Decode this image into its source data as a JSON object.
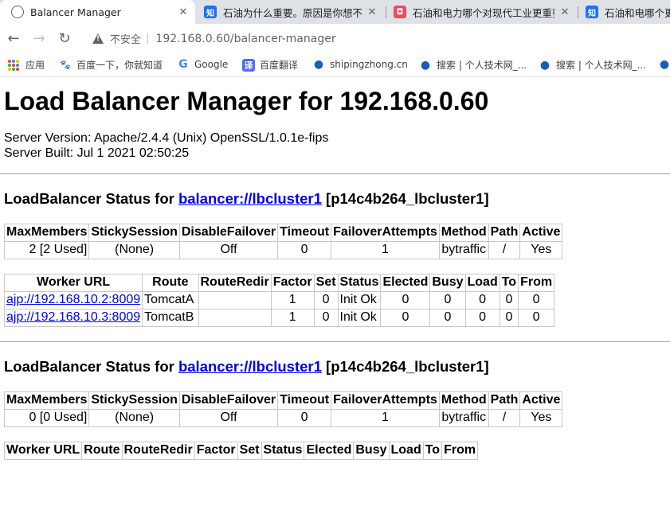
{
  "browser": {
    "tabs": [
      {
        "title": "Balancer Manager",
        "close": "✕",
        "icon": "globe-icon"
      },
      {
        "title": "石油为什么重要。原因是你想不到",
        "close": "✕",
        "icon": "zhihu-icon"
      },
      {
        "title": "石油和电力哪个对现代工业更重要",
        "close": "✕",
        "icon": "bilibili-icon"
      },
      {
        "title": "石油和电哪个更重",
        "close": "",
        "icon": "zhihu-icon"
      }
    ],
    "security_label": "不安全",
    "url": "192.168.0.60/balancer-manager",
    "bookmarks": [
      {
        "label": "应用",
        "icon": "apps-grid-icon"
      },
      {
        "label": "百度一下，你就知道",
        "icon": "baidu-paw-icon"
      },
      {
        "label": "Google",
        "icon": "google-g-icon"
      },
      {
        "label": "百度翻译",
        "icon": "baidu-translate-icon"
      },
      {
        "label": "shipingzhong.cn",
        "icon": "droplet-icon"
      },
      {
        "label": "搜索 | 个人技术网_...",
        "icon": "droplet-icon"
      },
      {
        "label": "搜索 | 个人技术网_...",
        "icon": "droplet-icon"
      }
    ]
  },
  "page": {
    "title": "Load Balancer Manager for 192.168.0.60",
    "server_version": "Server Version: Apache/2.4.4 (Unix) OpenSSL/1.0.1e-fips",
    "server_built": "Server Built: Jul 1 2021 02:50:25",
    "balancer_headers": [
      "MaxMembers",
      "StickySession",
      "DisableFailover",
      "Timeout",
      "FailoverAttempts",
      "Method",
      "Path",
      "Active"
    ],
    "worker_headers": [
      "Worker URL",
      "Route",
      "RouteRedir",
      "Factor",
      "Set",
      "Status",
      "Elected",
      "Busy",
      "Load",
      "To",
      "From"
    ],
    "sections": [
      {
        "heading_prefix": "LoadBalancer Status for",
        "balancer_link": "balancer://lbcluster1",
        "heading_suffix": "[p14c4b264_lbcluster1]",
        "balancer_row": [
          "2 [2 Used]",
          "(None)",
          "Off",
          "0",
          "1",
          "bytraffic",
          "/",
          "Yes"
        ],
        "workers": [
          [
            "ajp://192.168.10.2:8009",
            "TomcatA",
            "",
            "1",
            "0",
            "Init Ok",
            "0",
            "0",
            "0",
            "0",
            "0"
          ],
          [
            "ajp://192.168.10.3:8009",
            "TomcatB",
            "",
            "1",
            "0",
            "Init Ok",
            "0",
            "0",
            "0",
            "0",
            "0"
          ]
        ]
      },
      {
        "heading_prefix": "LoadBalancer Status for",
        "balancer_link": "balancer://lbcluster1",
        "heading_suffix": "[p14c4b264_lbcluster1]",
        "balancer_row": [
          "0 [0 Used]",
          "(None)",
          "Off",
          "0",
          "1",
          "bytraffic",
          "/",
          "Yes"
        ],
        "workers": []
      }
    ]
  }
}
